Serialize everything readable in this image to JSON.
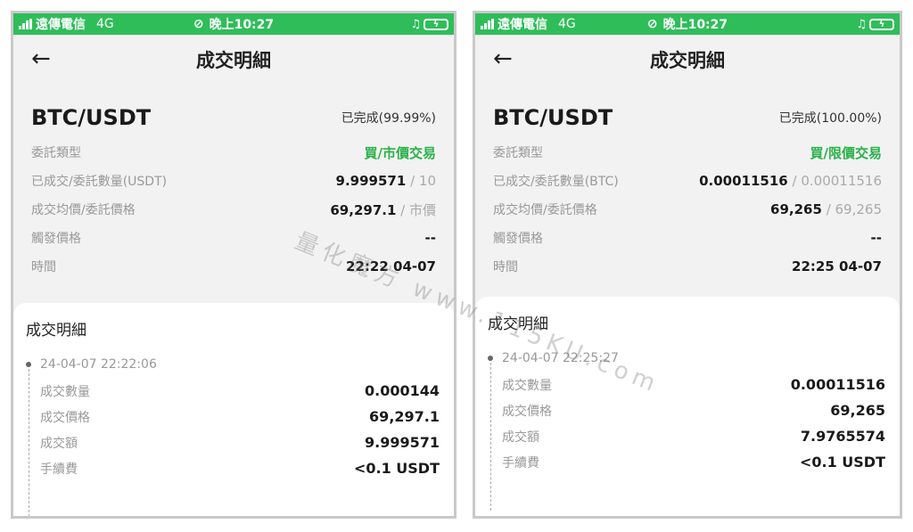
{
  "status_bar": {
    "carrier": "遠傳電信",
    "network": "4G",
    "time": "晚上10:27",
    "icons": [
      "signal-icon",
      "link-icon",
      "headphones-icon",
      "battery-charging-icon"
    ]
  },
  "left": {
    "nav": {
      "title": "成交明細"
    },
    "order": {
      "pair": "BTC/USDT",
      "status": "已完成(99.99%)",
      "rows": [
        {
          "label": "委託類型",
          "value": "買/市價交易"
        },
        {
          "label": "已成交/委託數量(USDT)",
          "value": "9.999571",
          "value2": " / 10"
        },
        {
          "label": "成交均價/委託價格",
          "value": "69,297.1",
          "value2": " / 市價"
        },
        {
          "label": "觸發價格",
          "value": "--"
        },
        {
          "label": "時間",
          "value": "22:22 04-07"
        }
      ]
    },
    "details": {
      "title": "成交明細",
      "time": "24-04-07 22:22:06",
      "rows": [
        {
          "label": "成交數量",
          "value": "0.000144"
        },
        {
          "label": "成交價格",
          "value": "69,297.1"
        },
        {
          "label": "成交額",
          "value": "9.999571"
        },
        {
          "label": "手續費",
          "value": "<0.1 USDT"
        }
      ]
    }
  },
  "right": {
    "nav": {
      "title": "成交明細"
    },
    "order": {
      "pair": "BTC/USDT",
      "status": "已完成(100.00%)",
      "rows": [
        {
          "label": "委託類型",
          "value": "買/限價交易"
        },
        {
          "label": "已成交/委託數量(BTC)",
          "value": "0.00011516",
          "value2": " / 0.00011516"
        },
        {
          "label": "成交均價/委託價格",
          "value": "69,265",
          "value2": " / 69,265"
        },
        {
          "label": "觸發價格",
          "value": "--"
        },
        {
          "label": "時間",
          "value": "22:25 04-07"
        }
      ]
    },
    "details": {
      "title": "成交明細",
      "time": "24-04-07 22:25:27",
      "rows": [
        {
          "label": "成交數量",
          "value": "0.00011516"
        },
        {
          "label": "成交價格",
          "value": "69,265"
        },
        {
          "label": "成交額",
          "value": "7.9765574"
        },
        {
          "label": "手續費",
          "value": "<0.1 USDT"
        }
      ]
    }
  },
  "watermark": "量化魔方 www.115KU.com",
  "colors": {
    "status_bar": "#2fbd5a",
    "buy_green": "#2bb14a",
    "label_gray": "#999999"
  }
}
